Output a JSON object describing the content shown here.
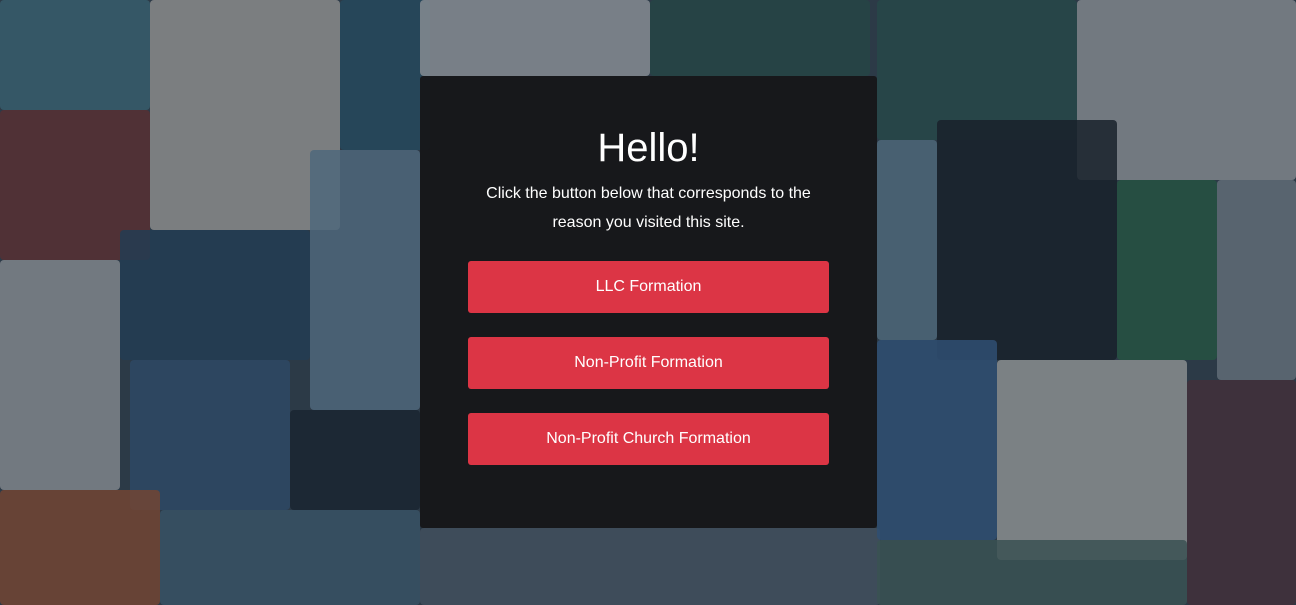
{
  "colors": {
    "button_bg": "#dc3545",
    "card_bg": "#161618",
    "text": "#ffffff"
  },
  "background": {
    "description_icon": "blurred-collage-background"
  },
  "card": {
    "heading": "Hello!",
    "subtitle": "Click the button below that corresponds to the reason you visited this site.",
    "buttons": [
      {
        "label": "LLC Formation"
      },
      {
        "label": "Non-Profit Formation"
      },
      {
        "label": "Non-Profit Church Formation"
      }
    ]
  }
}
